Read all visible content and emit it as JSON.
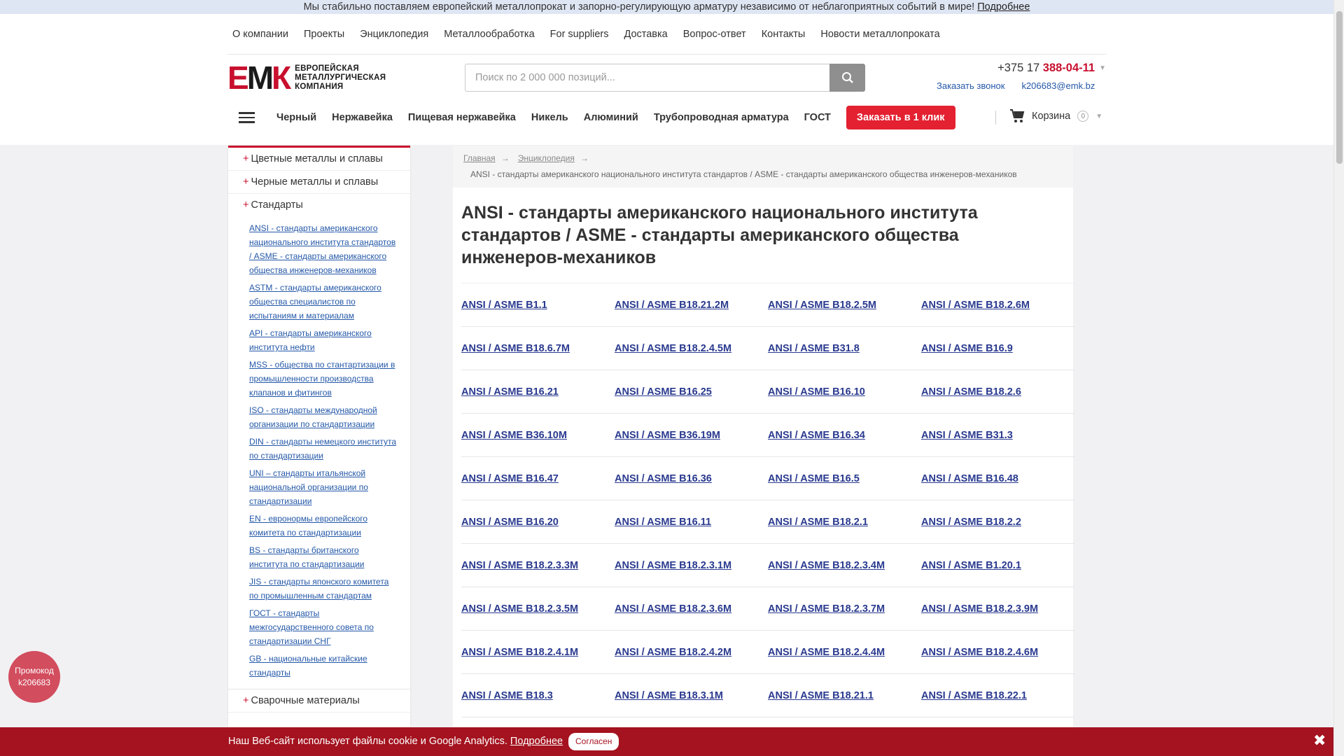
{
  "announce": {
    "text": "Мы стабильно поставляем европейский металлопрокат и запорно-регулирующую арматуру независимо от неблагоприятных событий в мире!",
    "link": "Подробнее"
  },
  "top_menu": [
    "О компании",
    "Проекты",
    "Энциклопедия",
    "Металлообработка",
    "For suppliers",
    "Доставка",
    "Вопрос-ответ",
    "Контакты",
    "Новости металлопроката"
  ],
  "logo": {
    "mark": [
      "Е",
      "М",
      "К"
    ],
    "lines": [
      "ЕВРОПЕЙСКАЯ",
      "МЕТАЛЛУРГИЧЕСКАЯ",
      "КОМПАНИЯ"
    ]
  },
  "search": {
    "placeholder": "Поиск по 2 000 000 позиций..."
  },
  "header": {
    "phone_prefix": "+375 17 ",
    "phone_number": "388-04-11",
    "callback": "Заказать звонок",
    "email": "k206683@emk.bz"
  },
  "categories": [
    "Черный",
    "Нержавейка",
    "Пищевая нержавейка",
    "Никель",
    "Алюминий",
    "Трубопроводная арматура",
    "ГОСТ"
  ],
  "one_click": "Заказать в 1 клик",
  "cart": {
    "label": "Корзина",
    "count": "0"
  },
  "sidebar": {
    "top_items": [
      "Цветные металлы и сплавы",
      "Черные металлы и сплавы",
      "Стандарты"
    ],
    "sub_items": [
      "ANSI - стандарты американского национального института стандартов / ASME - стандарты американского общества инженеров-механиков",
      "ASTM - стандарты американского общества специалистов по испытаниям и материалам",
      "API - стандарты американского института нефти",
      "MSS - общества по стантартизации в промышленности производства клапанов и фитингов",
      "ISO - стандарты международной организации по стандартизации",
      "DIN - стандарты немецкого института по стандартизации",
      "UNI – стандарты итальянской национальной организации по стандартизации",
      "EN - евронормы европейского комитета по стандартизации",
      "BS - стандарты британского института по стандартизации",
      "JIS - стандарты японского комитета по промышленным стандартам",
      "ГОСТ - стандарты межгосударственного совета по стандартизации СНГ",
      "GB - национальные китайские стандарты"
    ],
    "bottom_item": "Сварочные материалы"
  },
  "breadcrumb": {
    "home": "Главная",
    "encyclopedia": "Энциклопедия",
    "arrow": "→",
    "current": "ANSI - стандарты американского национального института стандартов / ASME - стандарты американского общества инженеров-механиков"
  },
  "page_title": "ANSI - стандарты американского национального института стандартов / ASME - стандарты американского общества инженеров-механиков",
  "standards": [
    [
      "ANSI / ASME B1.1",
      "ANSI / ASME B18.21.2M",
      "ANSI / ASME B18.2.5M",
      "ANSI / ASME B18.2.6M"
    ],
    [
      "ANSI / ASME B18.6.7M",
      "ANSI / ASME B18.2.4.5M",
      "ANSI / ASME B31.8",
      "ANSI / ASME B16.9"
    ],
    [
      "ANSI / ASME B16.21",
      "ANSI / ASME B16.25",
      "ANSI / ASME B16.10",
      "ANSI / ASME B18.2.6"
    ],
    [
      "ANSI / ASME B36.10M",
      "ANSI / ASME B36.19M",
      "ANSI / ASME B16.34",
      "ANSI / ASME B31.3"
    ],
    [
      "ANSI / ASME B16.47",
      "ANSI / ASME B16.36",
      "ANSI / ASME B16.5",
      "ANSI / ASME B16.48"
    ],
    [
      "ANSI / ASME B16.20",
      "ANSI / ASME B16.11",
      "ANSI / ASME B18.2.1",
      "ANSI / ASME B18.2.2"
    ],
    [
      "ANSI / ASME B18.2.3.3M",
      "ANSI / ASME B18.2.3.1M",
      "ANSI / ASME B18.2.3.4M",
      "ANSI / ASME B1.20.1"
    ],
    [
      "ANSI / ASME B18.2.3.5M",
      "ANSI / ASME B18.2.3.6M",
      "ANSI / ASME B18.2.3.7M",
      "ANSI / ASME B18.2.3.9M"
    ],
    [
      "ANSI / ASME B18.2.4.1M",
      "ANSI / ASME B18.2.4.2M",
      "ANSI / ASME B18.2.4.4M",
      "ANSI / ASME B18.2.4.6M"
    ],
    [
      "ANSI / ASME B18.3",
      "ANSI / ASME B18.3.1M",
      "ANSI / ASME B18.21.1",
      "ANSI / ASME B18.22.1"
    ]
  ],
  "promo": {
    "line1": "Промокод",
    "line2": "k206683"
  },
  "cookie": {
    "text": "Наш Веб-сайт использует файлы cookie и Google Analytics.",
    "link": "Подробнее",
    "accept": "Согласен",
    "close": "✖"
  },
  "colors": {
    "accent_red": "#c8102e",
    "link_blue": "#2458a8",
    "cookie_bar": "#a4131f"
  }
}
